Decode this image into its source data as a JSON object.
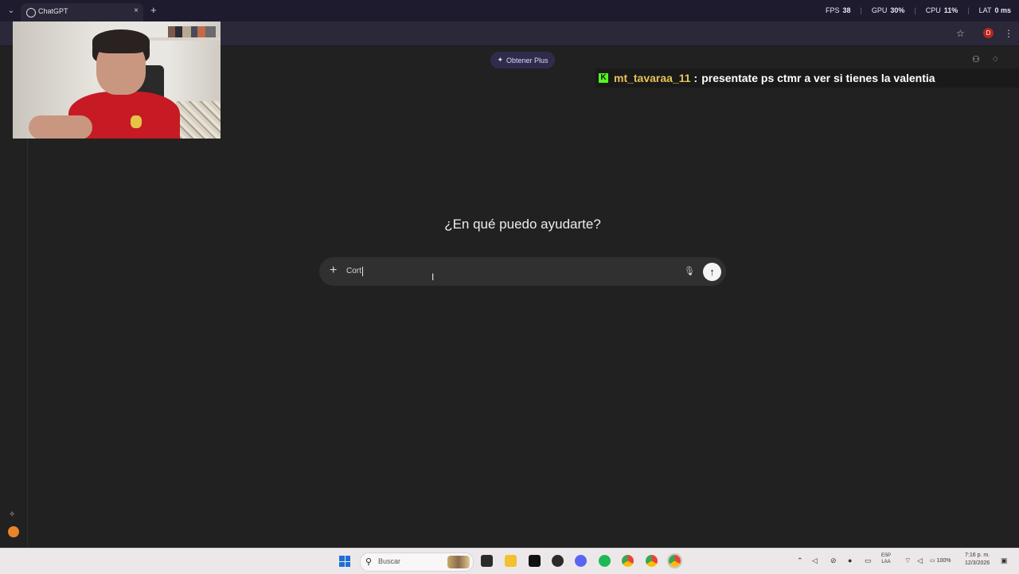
{
  "browser": {
    "tab_title": "ChatGPT",
    "tab_close": "×",
    "new_tab": "+"
  },
  "stats": {
    "fps_label": "FPS",
    "fps_value": "38",
    "gpu_label": "GPU",
    "gpu_value": "30%",
    "cpu_label": "CPU",
    "cpu_value": "11%",
    "lat_label": "LAT",
    "lat_value": "0 ms"
  },
  "profile_initial": "D",
  "main": {
    "get_plus_label": "Obtener Plus",
    "headline": "¿En qué puedo ayudarte?",
    "composer_text": "Cort"
  },
  "stream_chat": {
    "username": "mt_tavaraa_11",
    "separator": ":",
    "message": "presentate ps ctmr a ver si tienes la valentia"
  },
  "taskbar": {
    "search_placeholder": "Buscar",
    "lang_primary": "ESP",
    "lang_secondary": "LAA",
    "battery": "100%",
    "time": "7:16 p. m.",
    "date": "12/3/2026"
  },
  "colors": {
    "background": "#212121",
    "composer": "#303030",
    "plus_button": "#2f2c4b",
    "kick_green": "#53fc18",
    "chat_username": "#eac15a",
    "windows_blue": "#1f6fd6"
  }
}
